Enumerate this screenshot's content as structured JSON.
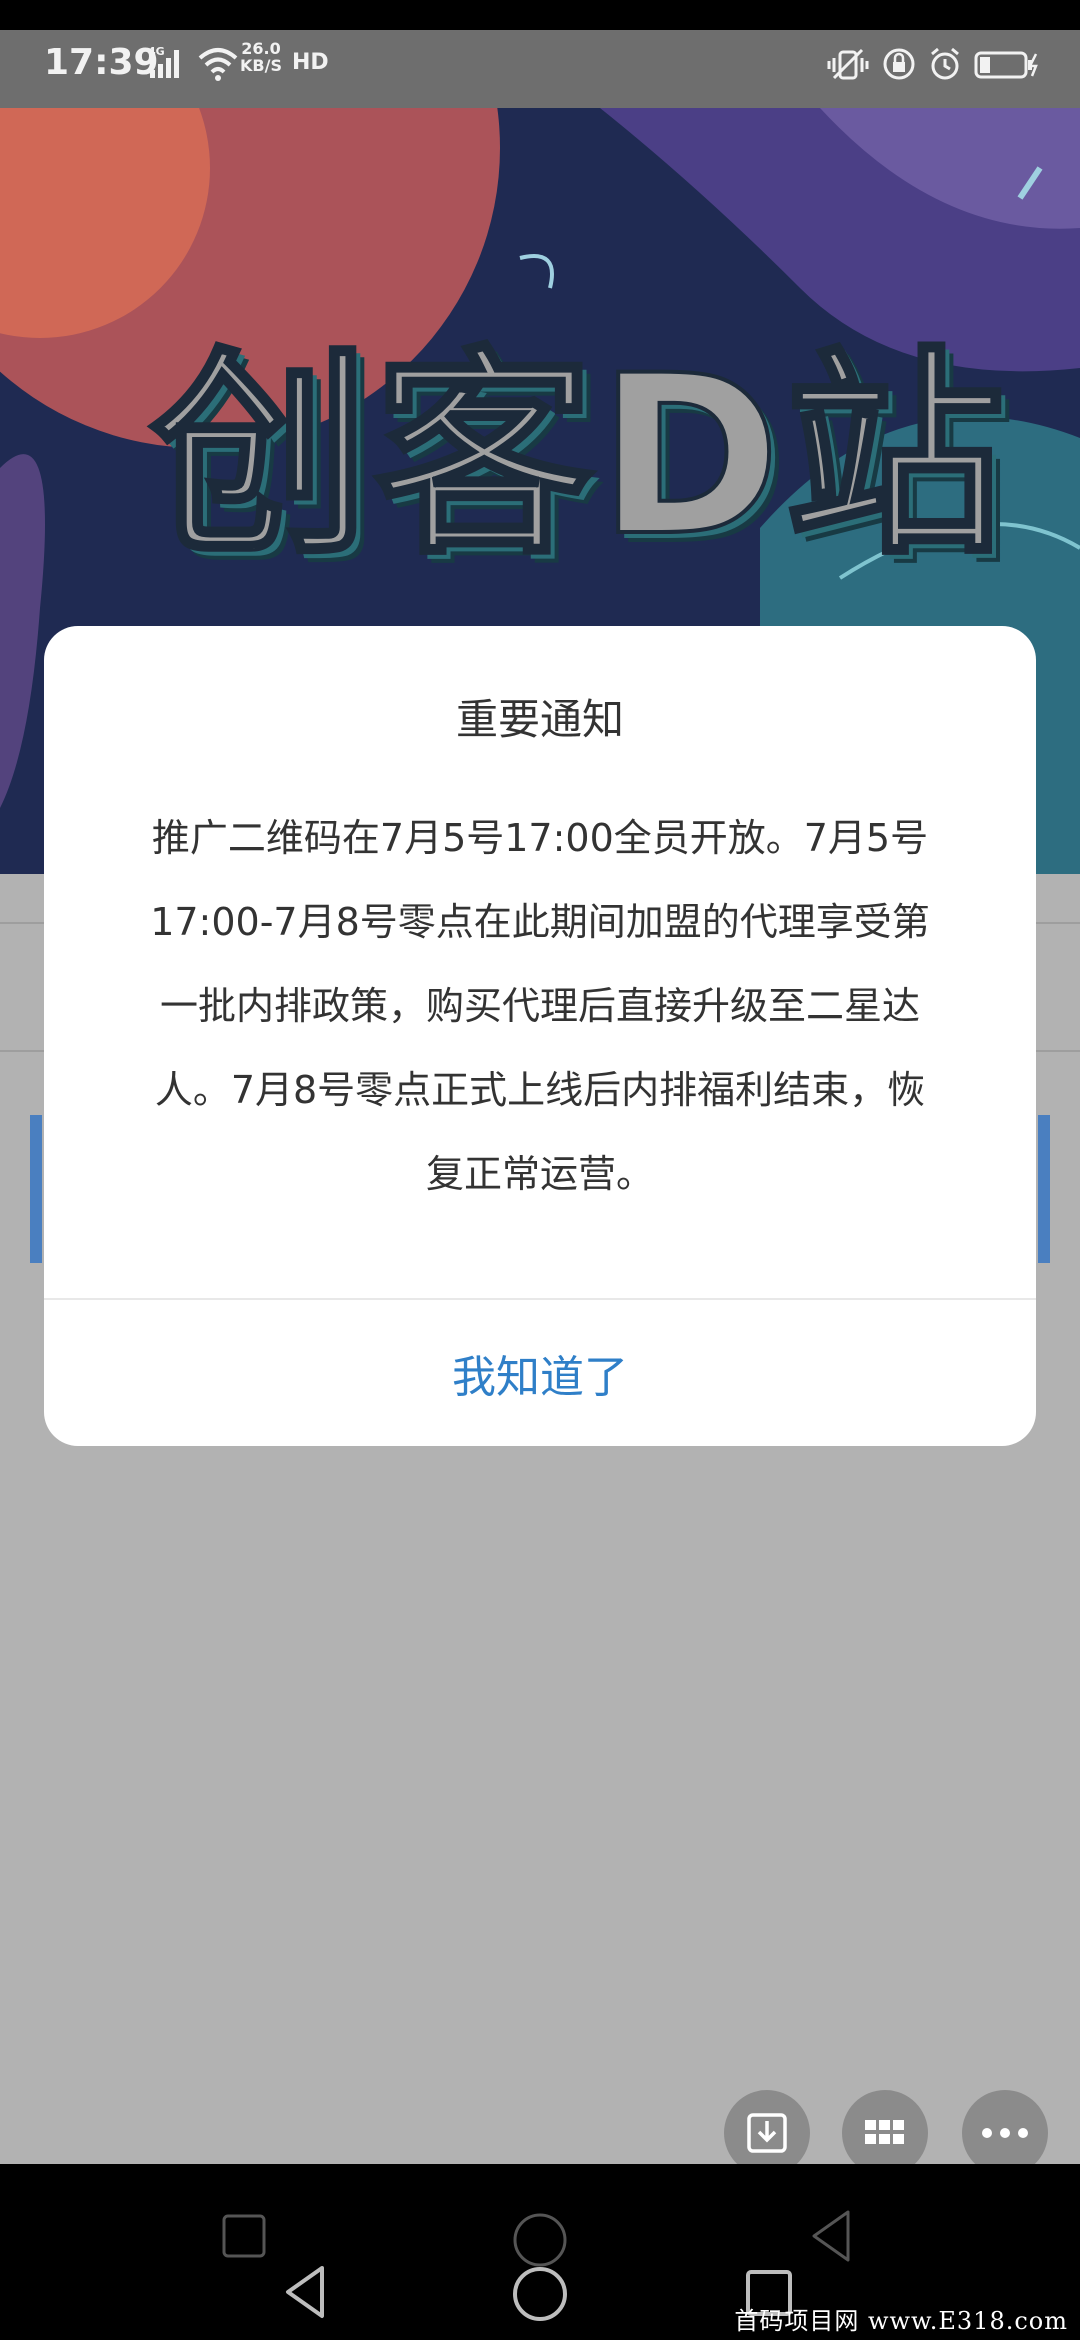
{
  "status_bar": {
    "time": "17:39",
    "network_type": "4G",
    "speed_value": "26.0",
    "speed_unit": "KB/S",
    "hd_label": "HD"
  },
  "banner": {
    "title": "创客D站"
  },
  "dialog": {
    "title": "重要通知",
    "body_lines": [
      "推广二维码在7月5号17:00全员开放。7月5号",
      "17:00-7月8号零点在此期间加盟的代理享受第",
      "一批内排政策，购买代理后直接升级至二星达",
      "人。7月8号零点正式上线后内排福利结束，恢",
      "复正常运营。"
    ],
    "confirm_label": "我知道了",
    "accent_color": "#2f7fc8"
  },
  "floating_buttons": [
    "download-icon",
    "grid-icon",
    "more-icon"
  ],
  "watermark": "首码项目网 www.E318.com"
}
